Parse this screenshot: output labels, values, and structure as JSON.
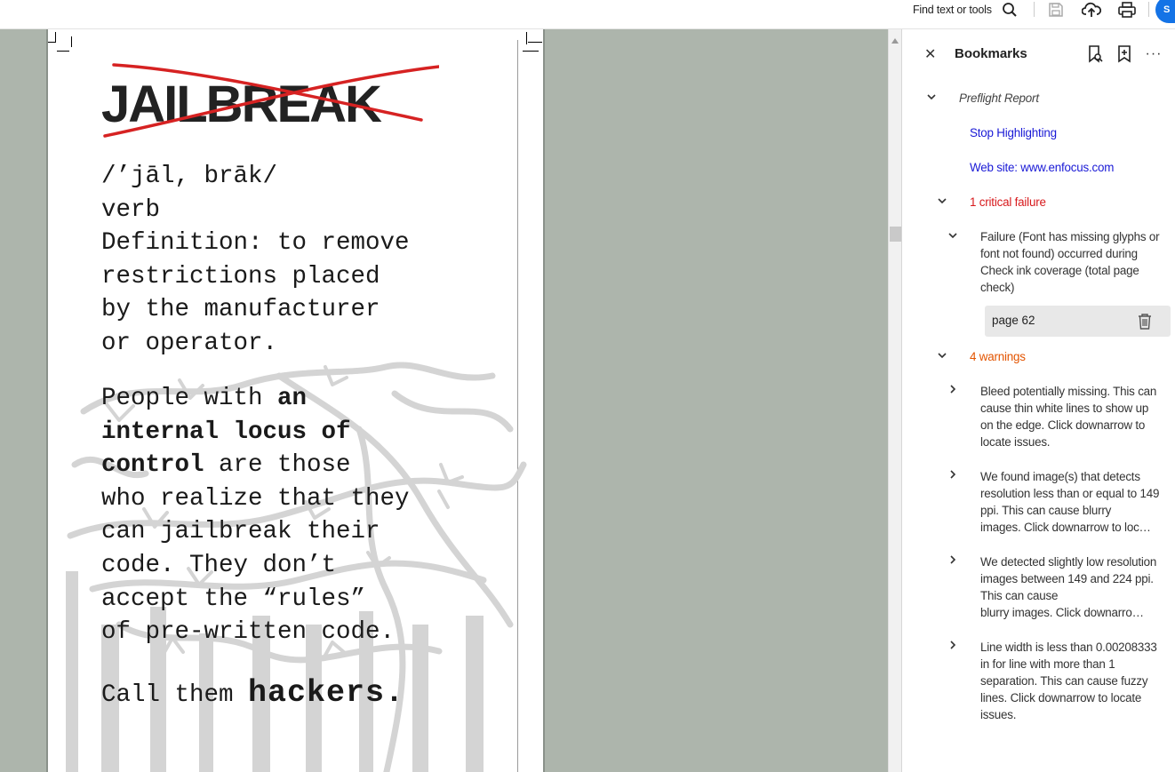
{
  "toolbar": {
    "find_text": "Find text or tools",
    "sign_label": "S",
    "icons": [
      "search-icon",
      "save-icon",
      "cloud-upload-icon",
      "print-icon"
    ]
  },
  "document": {
    "title": "JAILBREAK",
    "definition_lines": [
      "/’jāl, brāk/",
      "verb",
      "Definition: to remove",
      "restrictions placed",
      "by the manufacturer",
      "or operator."
    ],
    "paragraph": {
      "line1_a": "People with ",
      "line1_b": "an",
      "line2": "internal locus of",
      "line3_a": "control",
      "line3_b": " are those",
      "line4": "who realize that they",
      "line5": "can jailbreak their",
      "line6": "code. They don’t",
      "line7": "accept the “rules”",
      "line8": "of pre-written code."
    },
    "closing_a": "Call them ",
    "closing_b": "hackers."
  },
  "bookmarks": {
    "title": "Bookmarks",
    "preflight": "Preflight Report",
    "stop_highlighting": "Stop Highlighting",
    "website": "Web site: www.enfocus.com",
    "critical": "1 critical failure",
    "failure": "Failure (Font has missing glyphs or font not found) occurred during Check ink coverage (total page check)",
    "page": "page 62",
    "warnings": "4 warnings",
    "warning_items": [
      "Bleed potentially missing. This can cause thin white lines to show up on the edge. Click downarrow to locate issues.",
      "We found image(s) that detects resolution less than or equal to 149 ppi. This can cause blurry images. Click downarrow to locate issues.",
      "We detected slightly low resolution images between 149 and 224 ppi. This can cause blurry images.  Click downarrow to locate issues.",
      "Line width is less than 0.00208333 in for line with more than 1 separation. This can cause fuzzy lines. Click downarrow to locate issues."
    ],
    "warning_truncated": [
      "images. Click downarrow to loc…",
      "blurry images.  Click downarro…"
    ],
    "colors": {
      "link": "#1a1ad6",
      "critical": "#d7191c",
      "warning": "#e35400"
    }
  }
}
